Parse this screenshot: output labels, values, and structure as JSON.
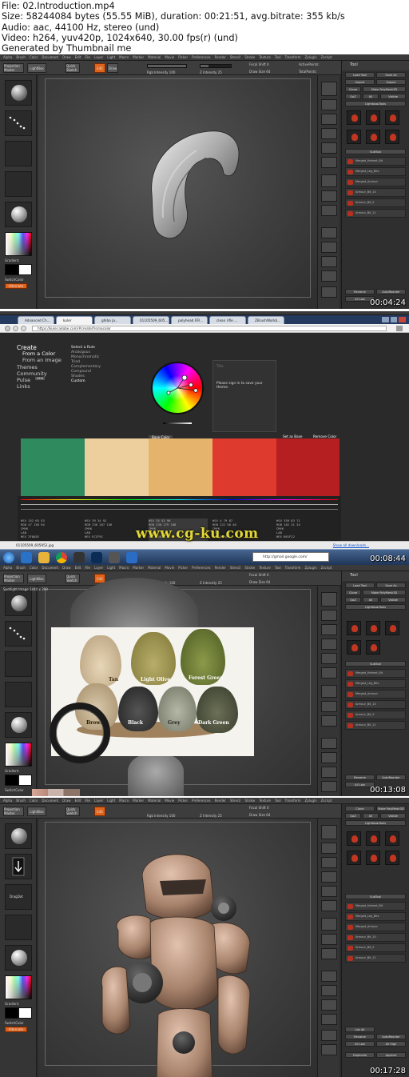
{
  "file_info": {
    "file": "File: 02.Introduction.mp4",
    "size": "Size: 58244084 bytes (55.55 MiB), duration: 00:21:51, avg.bitrate: 355 kb/s",
    "audio": "Audio: aac, 44100 Hz, stereo (und)",
    "video": "Video: h264, yuv420p, 1024x640, 30.00 fps(r) (und)",
    "generator": "Generated by Thumbnail me"
  },
  "frames": [
    {
      "timestamp": "00:04:24"
    },
    {
      "timestamp": "00:08:44"
    },
    {
      "timestamp": "00:13:08"
    },
    {
      "timestamp": "00:17:28"
    }
  ],
  "zbrush": {
    "panel_title": "Tool",
    "quick_sketch": "Quick Sketch",
    "subtool": "SubTool",
    "lightbox": "LightBox",
    "projection_master": "Projection Master",
    "edit": "Edit",
    "draw": "Draw",
    "rgb_intensity": "Rgb Intensity 100",
    "z_intensity": "Z Intensity 25",
    "focal_shift": "Focal Shift 0",
    "draw_size": "Draw Size 64",
    "active_points": "ActivePoints:",
    "total_points": "TotalPoints:",
    "gradient": "Gradient",
    "switch_color": "SwitchColor",
    "alternate": "Alternate",
    "load_tool": "Load Tool",
    "save_as": "Save As",
    "import": "Import",
    "export": "Export",
    "clone": "Clone",
    "make_polymesh": "Make PolyMesh3D",
    "goz": "GoZ",
    "all": "All",
    "visible": "Visible",
    "lightbox_tools": "Lightbox▸Tools",
    "subtool_items": [
      "Merged_Helmet_Bit",
      "Merged_Leg_Bits",
      "Merged_Armour",
      "Armour_Bit_10",
      "Armour_Bit_5",
      "Armour_Bit_11"
    ],
    "rename": "Rename",
    "autoreorder": "AutoReorder",
    "all_low": "All Low",
    "all_high": "All High",
    "duplicate": "Duplicate",
    "append": "Append",
    "list_all": "List All",
    "spotlight_image": "Spotlight Image 1440 x 399"
  },
  "browser": {
    "tabs": [
      "Advanced Ch...",
      "kuler",
      "ghibo ja...",
      "01105509_605...",
      "polyhead.FIR...",
      "clean rifle ...",
      "ZBrushWorkb..."
    ],
    "url": "https://kuler.adobe.com/#create/fromacolor",
    "download_file": "01105509_605952.jpg",
    "show_downloads": "Show all downloads...",
    "gmail_url": "http://gmail.google.com/"
  },
  "kuler": {
    "nav": [
      "Create",
      "From a Color",
      "From an Image",
      "Themes",
      "Community",
      "Pulse",
      "Links"
    ],
    "pulse_badge": "NEW",
    "select_rule": "Select a Rule",
    "rules": [
      "Analogous",
      "Monochromatic",
      "Triad",
      "Complementary",
      "Compound",
      "Shades",
      "Custom"
    ],
    "signin": "Please sign in to save your theme.",
    "title_placeholder": "Title",
    "base_color": "Base Color",
    "set_as_base": "Set as Base",
    "remove_color": "Remove Color",
    "swatches": [
      "#2f8a5e",
      "#eccf9c",
      "#e6b36c",
      "#de3a2e",
      "#b61f22"
    ],
    "values": [
      {
        "hsv": "152  65  53",
        "rgb": "47  138  94",
        "hex": "2F8A5E"
      },
      {
        "hsv": "39  34  92",
        "rgb": "236  207  156",
        "hex": "ECCF9C"
      },
      {
        "hsv": "35  53  90",
        "rgb": "230  179  108",
        "hex": "E6B36C"
      },
      {
        "hsv": "4  79  87",
        "rgb": "222  58  46",
        "hex": "DE3A2E"
      },
      {
        "hsv": "359  83  71",
        "rgb": "182  31  34",
        "hex": "B61F22"
      }
    ],
    "hsv_label": "HSV",
    "rgb_label": "RGB",
    "cmyk_label": "CMYK",
    "lab_label": "LAB",
    "hex_label": "HEX"
  },
  "watermark": "www.cg-ku.com",
  "fur_labels": [
    "Tan",
    "Light Olive",
    "Forest Green",
    "Brown",
    "Black",
    "Grey",
    "Dark Green"
  ]
}
